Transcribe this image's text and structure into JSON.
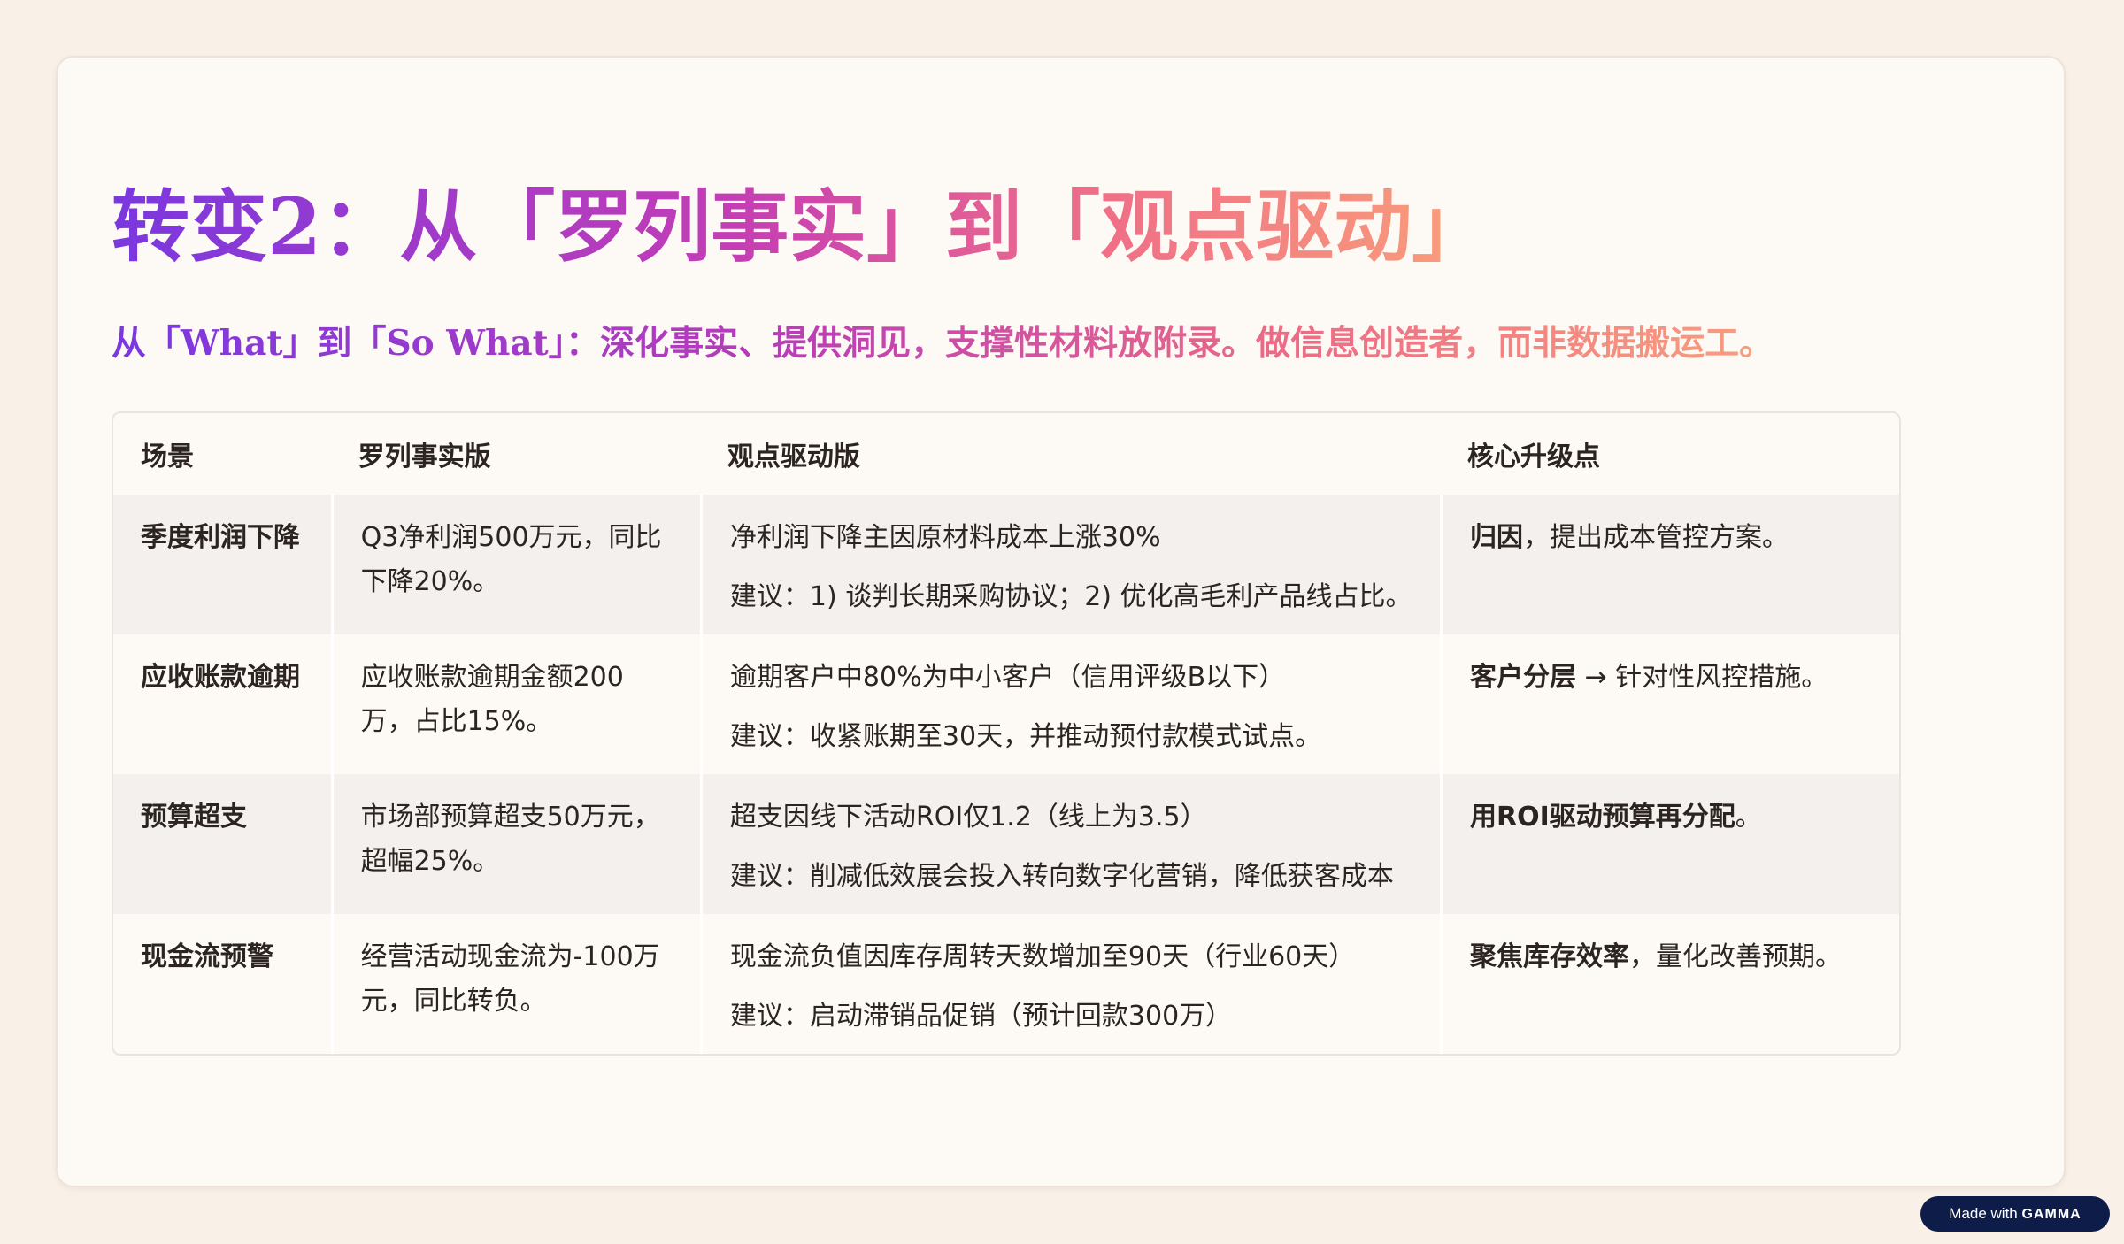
{
  "slide": {
    "title": "转变2：从「罗列事实」到「观点驱动」",
    "subtitle": "从「What」到「So What」：深化事实、提供洞见，支撑性材料放附录。做信息创造者，而非数据搬运工。"
  },
  "table": {
    "headers": [
      "场景",
      "罗列事实版",
      "观点驱动版",
      "核心升级点"
    ],
    "rows": [
      {
        "scene": "季度利润下降",
        "fact": "Q3净利润500万元，同比下降20%。",
        "view_1": "净利润下降主因原材料成本上涨30%",
        "view_2": "建议：1) 谈判长期采购协议；2) 优化高毛利产品线占比。",
        "upgrade_bold": "归因",
        "upgrade_rest": "，提出成本管控方案。"
      },
      {
        "scene": "应收账款逾期",
        "fact": "应收账款逾期金额200万，占比15%。",
        "view_1": "逾期客户中80%为中小客户（信用评级B以下）",
        "view_2": "建议：收紧账期至30天，并推动预付款模式试点。",
        "upgrade_bold": "客户分层",
        "upgrade_rest": " → 针对性风控措施。"
      },
      {
        "scene": "预算超支",
        "fact": "市场部预算超支50万元，超幅25%。",
        "view_1": "超支因线下活动ROI仅1.2（线上为3.5）",
        "view_2": "建议：削减低效展会投入转向数字化营销，降低获客成本",
        "upgrade_bold": "用ROI驱动预算再分配",
        "upgrade_rest": "。"
      },
      {
        "scene": "现金流预警",
        "fact": "经营活动现金流为-100万元，同比转负。",
        "view_1": "现金流负值因库存周转天数增加至90天（行业60天）",
        "view_2": "建议：启动滞销品促销（预计回款300万）",
        "upgrade_bold": "聚焦库存效率",
        "upgrade_rest": "，量化改善预期。"
      }
    ]
  },
  "badge": {
    "prefix": "Made with",
    "brand": "GAMMA"
  }
}
